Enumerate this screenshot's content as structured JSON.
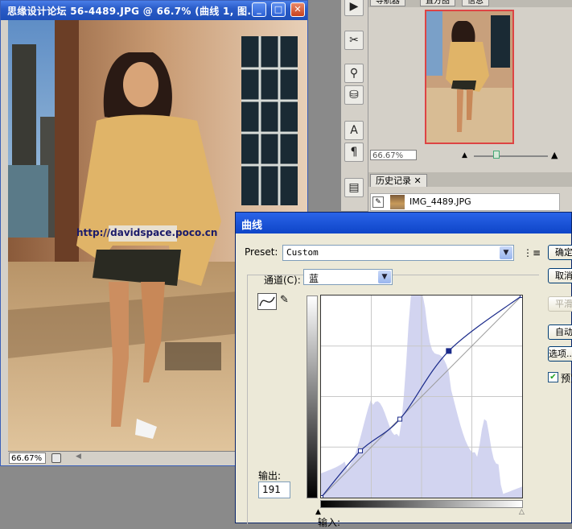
{
  "document": {
    "title": "思缘设计论坛 56-4489.JPG @ 66.7% (曲线 1, 图...",
    "zoom": "66.67%",
    "watermark_url": "http://davidspace.poco.cn"
  },
  "navigator": {
    "tabs": [
      "导航器",
      "直方图",
      "信息"
    ],
    "zoom": "66.67%",
    "zoom_slider_fraction": 0.3
  },
  "history": {
    "tab_label": "历史记录",
    "item_label": "IMG_4489.JPG"
  },
  "tools": [
    "play-icon",
    "scissors-icon",
    "usb-icon",
    "stamp-icon",
    "type-icon",
    "paragraph-icon",
    "notes-icon"
  ],
  "curves": {
    "title": "曲线",
    "preset_label": "Preset:",
    "preset_value": "Custom",
    "channel_label": "通道(C):",
    "channel_value": "蓝",
    "output_label": "输出:",
    "output_value": "191",
    "input_label": "输入:",
    "buttons": [
      "确定",
      "取消",
      "平滑",
      "自动",
      "选项..."
    ],
    "preview_label": "预览",
    "preview_checked": true,
    "curve_points": [
      [
        0,
        0
      ],
      [
        50,
        59
      ],
      [
        100,
        99
      ],
      [
        162,
        185
      ],
      [
        255,
        255
      ]
    ],
    "histogram_color": "#d2d4f0"
  }
}
